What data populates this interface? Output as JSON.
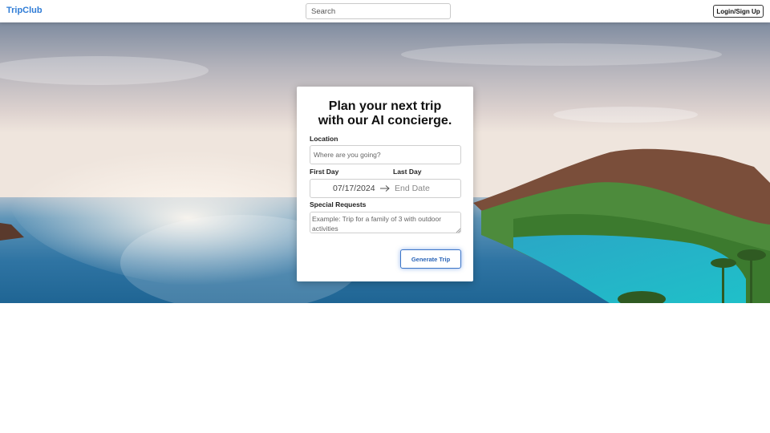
{
  "header": {
    "logo": "TripClub",
    "search_placeholder": "Search",
    "login_label": "Login/Sign Up"
  },
  "planner": {
    "title_line1": "Plan your next trip",
    "title_line2": "with our AI concierge.",
    "location_label": "Location",
    "location_placeholder": "Where are you going?",
    "first_day_label": "First Day",
    "last_day_label": "Last Day",
    "start_date": "07/17/2024",
    "end_date_placeholder": "End Date",
    "requests_label": "Special Requests",
    "requests_placeholder": "Example: Trip for a family of 3 with outdoor activities",
    "generate_label": "Generate Trip"
  },
  "colors": {
    "brand": "#2f7cd6",
    "button_accent": "#3a74c7"
  },
  "icons": {
    "date_separator": "arrow-right-icon",
    "textarea_handle": "resize-handle-icon"
  }
}
